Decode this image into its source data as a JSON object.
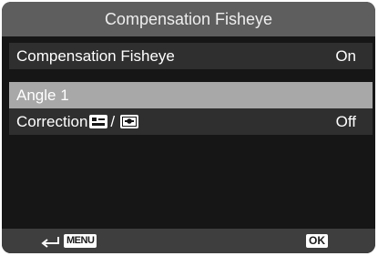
{
  "title": "Compensation Fisheye",
  "menu": {
    "compensation_fisheye": {
      "label": "Compensation Fisheye",
      "value": "On"
    },
    "angle": {
      "label": "Angle 1"
    },
    "correction": {
      "label": "Correction",
      "separator": "/",
      "value": "Off",
      "icons": [
        "scene-mode-icon",
        "portrait-mode-icon"
      ]
    }
  },
  "footer": {
    "back_icon": "back-arrow-icon",
    "menu_label": "MENU",
    "ok_label": "OK"
  },
  "colors": {
    "background": "#161616",
    "title_bar": "#5e5e5e",
    "row": "#2f2f2f",
    "selected_row": "#a8a8a8",
    "footer": "#3e3e3e"
  }
}
